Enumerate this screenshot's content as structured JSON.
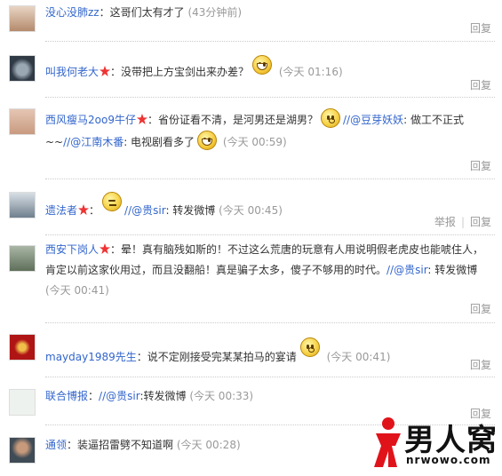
{
  "reply_label": "回复",
  "report_label": "举报",
  "comments": [
    {
      "user": "没心没肺zz",
      "vip": false,
      "sep": "：",
      "text": "这哥们太有才了",
      "time": "(43分钟前)",
      "emoticon": "",
      "avatar_color": "#c9a58a"
    },
    {
      "user": "叫我何老大",
      "vip": true,
      "sep": "：",
      "text": "没带把上方宝剑出来办差？",
      "time": "(今天 01:16)",
      "emoticon": "grin-emoticon",
      "avatar_color": "#3e4a57"
    },
    {
      "user": "西风瘦马2oo9牛仔",
      "vip": true,
      "sep": "：",
      "text_a": "省份证看不清，是河男还是湖男？",
      "mention1": "//@豆芽妖妖",
      "text_b": ": 做工不正式~~",
      "mention2": "//@江南木番",
      "text_c": ": 电视剧看多了",
      "time": "(今天 00:59)",
      "avatar_color": "#d7b19b"
    },
    {
      "user": "遗法者",
      "vip": true,
      "sep": "：",
      "mention": "//@贵sir",
      "text": ": 转发微博",
      "time": "(今天 00:45)",
      "emoticon": "smug-emoticon",
      "avatar_color": "#6b7c8a"
    },
    {
      "user": "西安下岗人",
      "vip": true,
      "sep": "：",
      "text": "晕！真有脑残如斯的！不过这么荒唐的玩意有人用说明假老虎皮也能唬住人，肯定以前这家伙用过，而且没翻船！真是骗子太多，傻子不够用的时代。",
      "mention": "//@贵sir",
      "text_b": ": 转发微博",
      "time": "(今天",
      "time2": "00:41)",
      "avatar_color": "#7e8f7a"
    },
    {
      "user": "mayday1989先生",
      "vip": false,
      "sep": "：",
      "text": "说不定刚接受完某某拍马的宴请",
      "time": "(今天 00:41)",
      "emoticon": "doubt-emoticon",
      "avatar_color": "#b01515"
    },
    {
      "user": "联合博报",
      "vip": false,
      "sep": "：",
      "mention": "//@贵sir",
      "text": ":转发微博",
      "time": "(今天 00:33)",
      "avatar_color": "#eef2ee"
    },
    {
      "user": "通领",
      "vip": false,
      "sep": "：",
      "text": "装逼招雷劈不知道啊",
      "time": "(今天 00:28)",
      "avatar_color": "#4a5560"
    }
  ],
  "watermark": {
    "brand": "男人窝",
    "url": "nrwowo.com"
  }
}
